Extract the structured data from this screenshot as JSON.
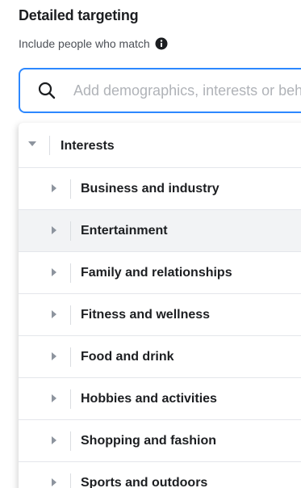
{
  "section": {
    "title": "Detailed targeting",
    "subtitle": "Include people who match"
  },
  "search": {
    "placeholder": "Add demographics, interests or behaviours",
    "value": ""
  },
  "tree": {
    "header": "Interests",
    "items": [
      {
        "label": "Business and industry"
      },
      {
        "label": "Entertainment"
      },
      {
        "label": "Family and relationships"
      },
      {
        "label": "Fitness and wellness"
      },
      {
        "label": "Food and drink"
      },
      {
        "label": "Hobbies and activities"
      },
      {
        "label": "Shopping and fashion"
      },
      {
        "label": "Sports and outdoors"
      }
    ]
  },
  "colors": {
    "accent": "#2d88ff",
    "hover_row": "#f2f3f5"
  }
}
